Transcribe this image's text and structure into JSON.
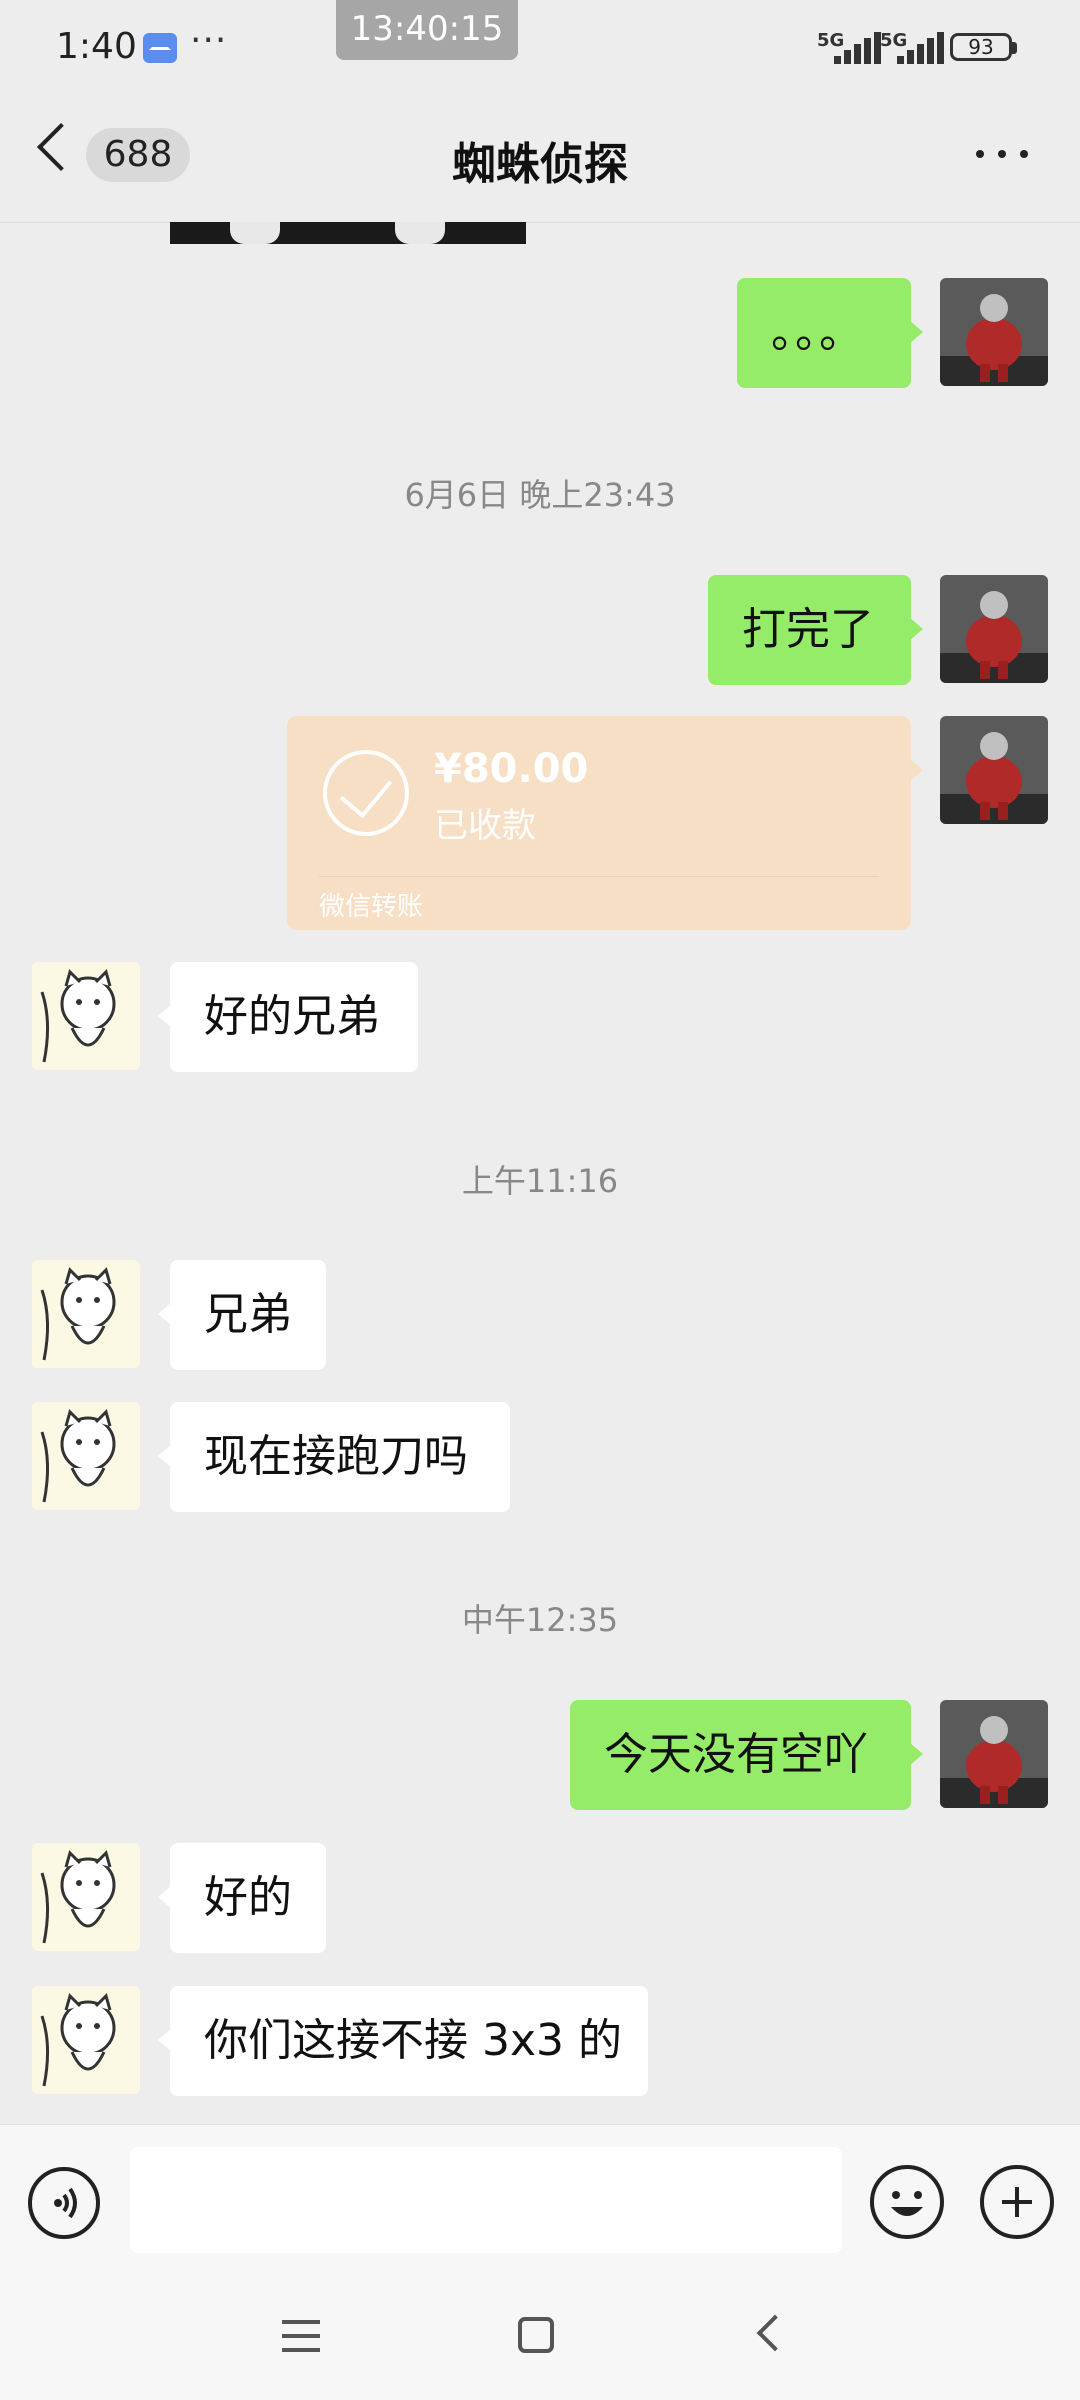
{
  "status_bar": {
    "time": "1:40",
    "more": "···",
    "clock": "13:40:15",
    "signal1": "5G",
    "signal2": "5G",
    "battery": "93"
  },
  "header": {
    "unread_count": "688",
    "title": "蜘蛛侦探"
  },
  "messages": [
    {
      "sender": "me",
      "type": "text",
      "text": "。。。"
    },
    {
      "type": "time",
      "text": "6月6日 晚上23:43"
    },
    {
      "sender": "me",
      "type": "text",
      "text": "打完了"
    },
    {
      "sender": "me",
      "type": "transfer",
      "amount": "¥80.00",
      "status": "已收款",
      "label": "微信转账"
    },
    {
      "sender": "other",
      "type": "text",
      "text": "好的兄弟"
    },
    {
      "type": "time",
      "text": "上午11:16"
    },
    {
      "sender": "other",
      "type": "text",
      "text": "兄弟"
    },
    {
      "sender": "other",
      "type": "text",
      "text": "现在接跑刀吗"
    },
    {
      "type": "time",
      "text": "中午12:35"
    },
    {
      "sender": "me",
      "type": "text",
      "text": "今天没有空吖"
    },
    {
      "sender": "other",
      "type": "text",
      "text": "好的"
    },
    {
      "sender": "other",
      "type": "text",
      "text": "你们这接不接 3x3 的"
    }
  ],
  "input": {
    "value": "",
    "placeholder": ""
  },
  "colors": {
    "background": "#ededed",
    "my_bubble": "#95ec69",
    "other_bubble": "#ffffff",
    "transfer_card": "#f7dfc5"
  }
}
